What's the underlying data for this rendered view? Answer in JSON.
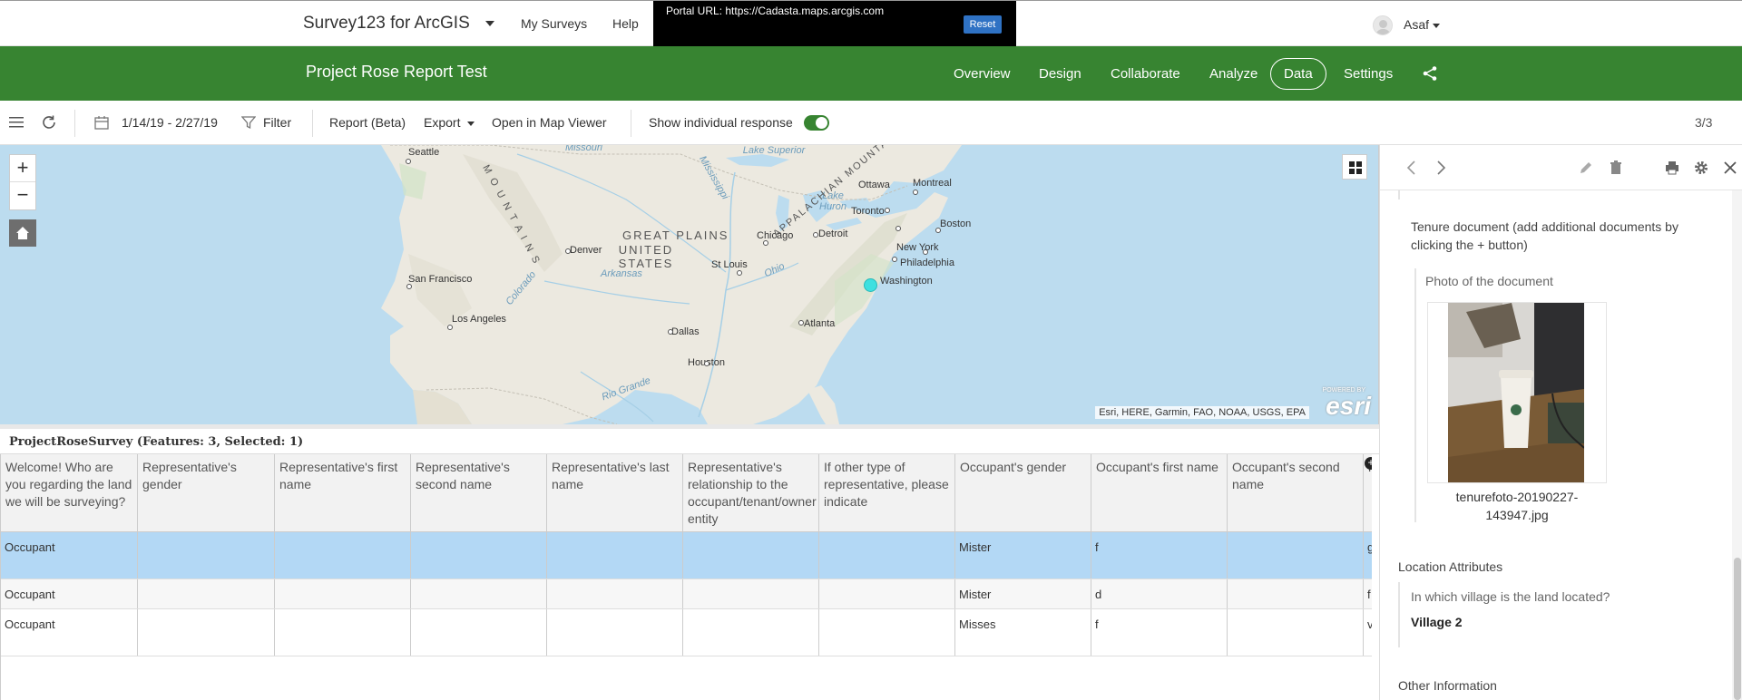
{
  "header": {
    "app_title": "Survey123 for ArcGIS",
    "links": {
      "my_surveys": "My Surveys",
      "help": "Help"
    },
    "portal_text": "Portal URL: https://Cadasta.maps.arcgis.com",
    "reset_label": "Reset",
    "user_name": "Asaf"
  },
  "nav": {
    "project_title": "Project Rose Report Test",
    "items": [
      "Overview",
      "Design",
      "Collaborate",
      "Analyze",
      "Data",
      "Settings"
    ],
    "active": "Data",
    "accent_color": "#378431"
  },
  "toolbar": {
    "date_range": "1/14/19 - 2/27/19",
    "filter_label": "Filter",
    "report_label": "Report (Beta)",
    "export_label": "Export",
    "map_viewer_label": "Open in Map Viewer",
    "show_individual_label": "Show individual response",
    "show_individual_on": true,
    "page_count": "3/3"
  },
  "map": {
    "labels": {
      "seattle": "Seattle",
      "missouri": "Missouri",
      "lake_superior": "Lake Superior",
      "ottawa": "Ottawa",
      "montreal": "Montreal",
      "toronto": "Toronto",
      "lake_huron": "Lake Huron",
      "great_plains": "GREAT PLAINS",
      "chicago": "Chicago",
      "detroit": "Detroit",
      "united_states": "UNITED STATES",
      "denver": "Denver",
      "st_louis": "St Louis",
      "san_francisco": "San Francisco",
      "new_york": "New York",
      "boston": "Boston",
      "philadelphia": "Philadelphia",
      "washington": "Washington",
      "los_angeles": "Los Angeles",
      "dallas": "Dallas",
      "atlanta": "Atlanta",
      "houston": "Houston",
      "appalachian": "APPALACHIAN MOUNTAINS",
      "rockies": "M O U N T A I N S",
      "arkansas": "Arkansas",
      "ohio": "Ohio",
      "colorado": "Colorado",
      "rio_grande": "Rio Grande",
      "mississippi": "Mississippi"
    },
    "zoom_in": "+",
    "zoom_out": "−",
    "attribution": "Esri, HERE, Garmin, FAO, NOAA, USGS, EPA",
    "logo": "esri",
    "logo_powered": "POWERED BY"
  },
  "table": {
    "caption": "ProjectRoseSurvey (Features: 3, Selected: 1)",
    "columns": [
      "Welcome! Who are you regarding the land we will be surveying?",
      "Representative's gender",
      "Representative's first name",
      "Representative's second name",
      "Representative's last name",
      "Representative's relationship to the occupant/tenant/owner entity",
      "If other type of representative, please indicate",
      "Occupant's gender",
      "Occupant's first name",
      "Occupant's second name",
      "r"
    ],
    "rows": [
      {
        "cells": [
          "Occupant",
          "",
          "",
          "",
          "",
          "",
          "",
          "Mister",
          "f",
          "",
          "g"
        ],
        "selected": true
      },
      {
        "cells": [
          "Occupant",
          "",
          "",
          "",
          "",
          "",
          "",
          "Mister",
          "d",
          "",
          "f"
        ],
        "selected": false
      },
      {
        "cells": [
          "Occupant",
          "",
          "",
          "",
          "",
          "",
          "",
          "Misses",
          "f",
          "",
          "v"
        ],
        "selected": false
      }
    ]
  },
  "panel": {
    "tenure_question": "Tenure document (add additional documents by clicking the + button)",
    "photo_label": "Photo of the document",
    "photo_caption": "tenurefoto-20190227-143947.jpg",
    "location_section": "Location Attributes",
    "village_question": "In which village is the land located?",
    "village_answer": "Village 2",
    "other_section": "Other Information"
  }
}
